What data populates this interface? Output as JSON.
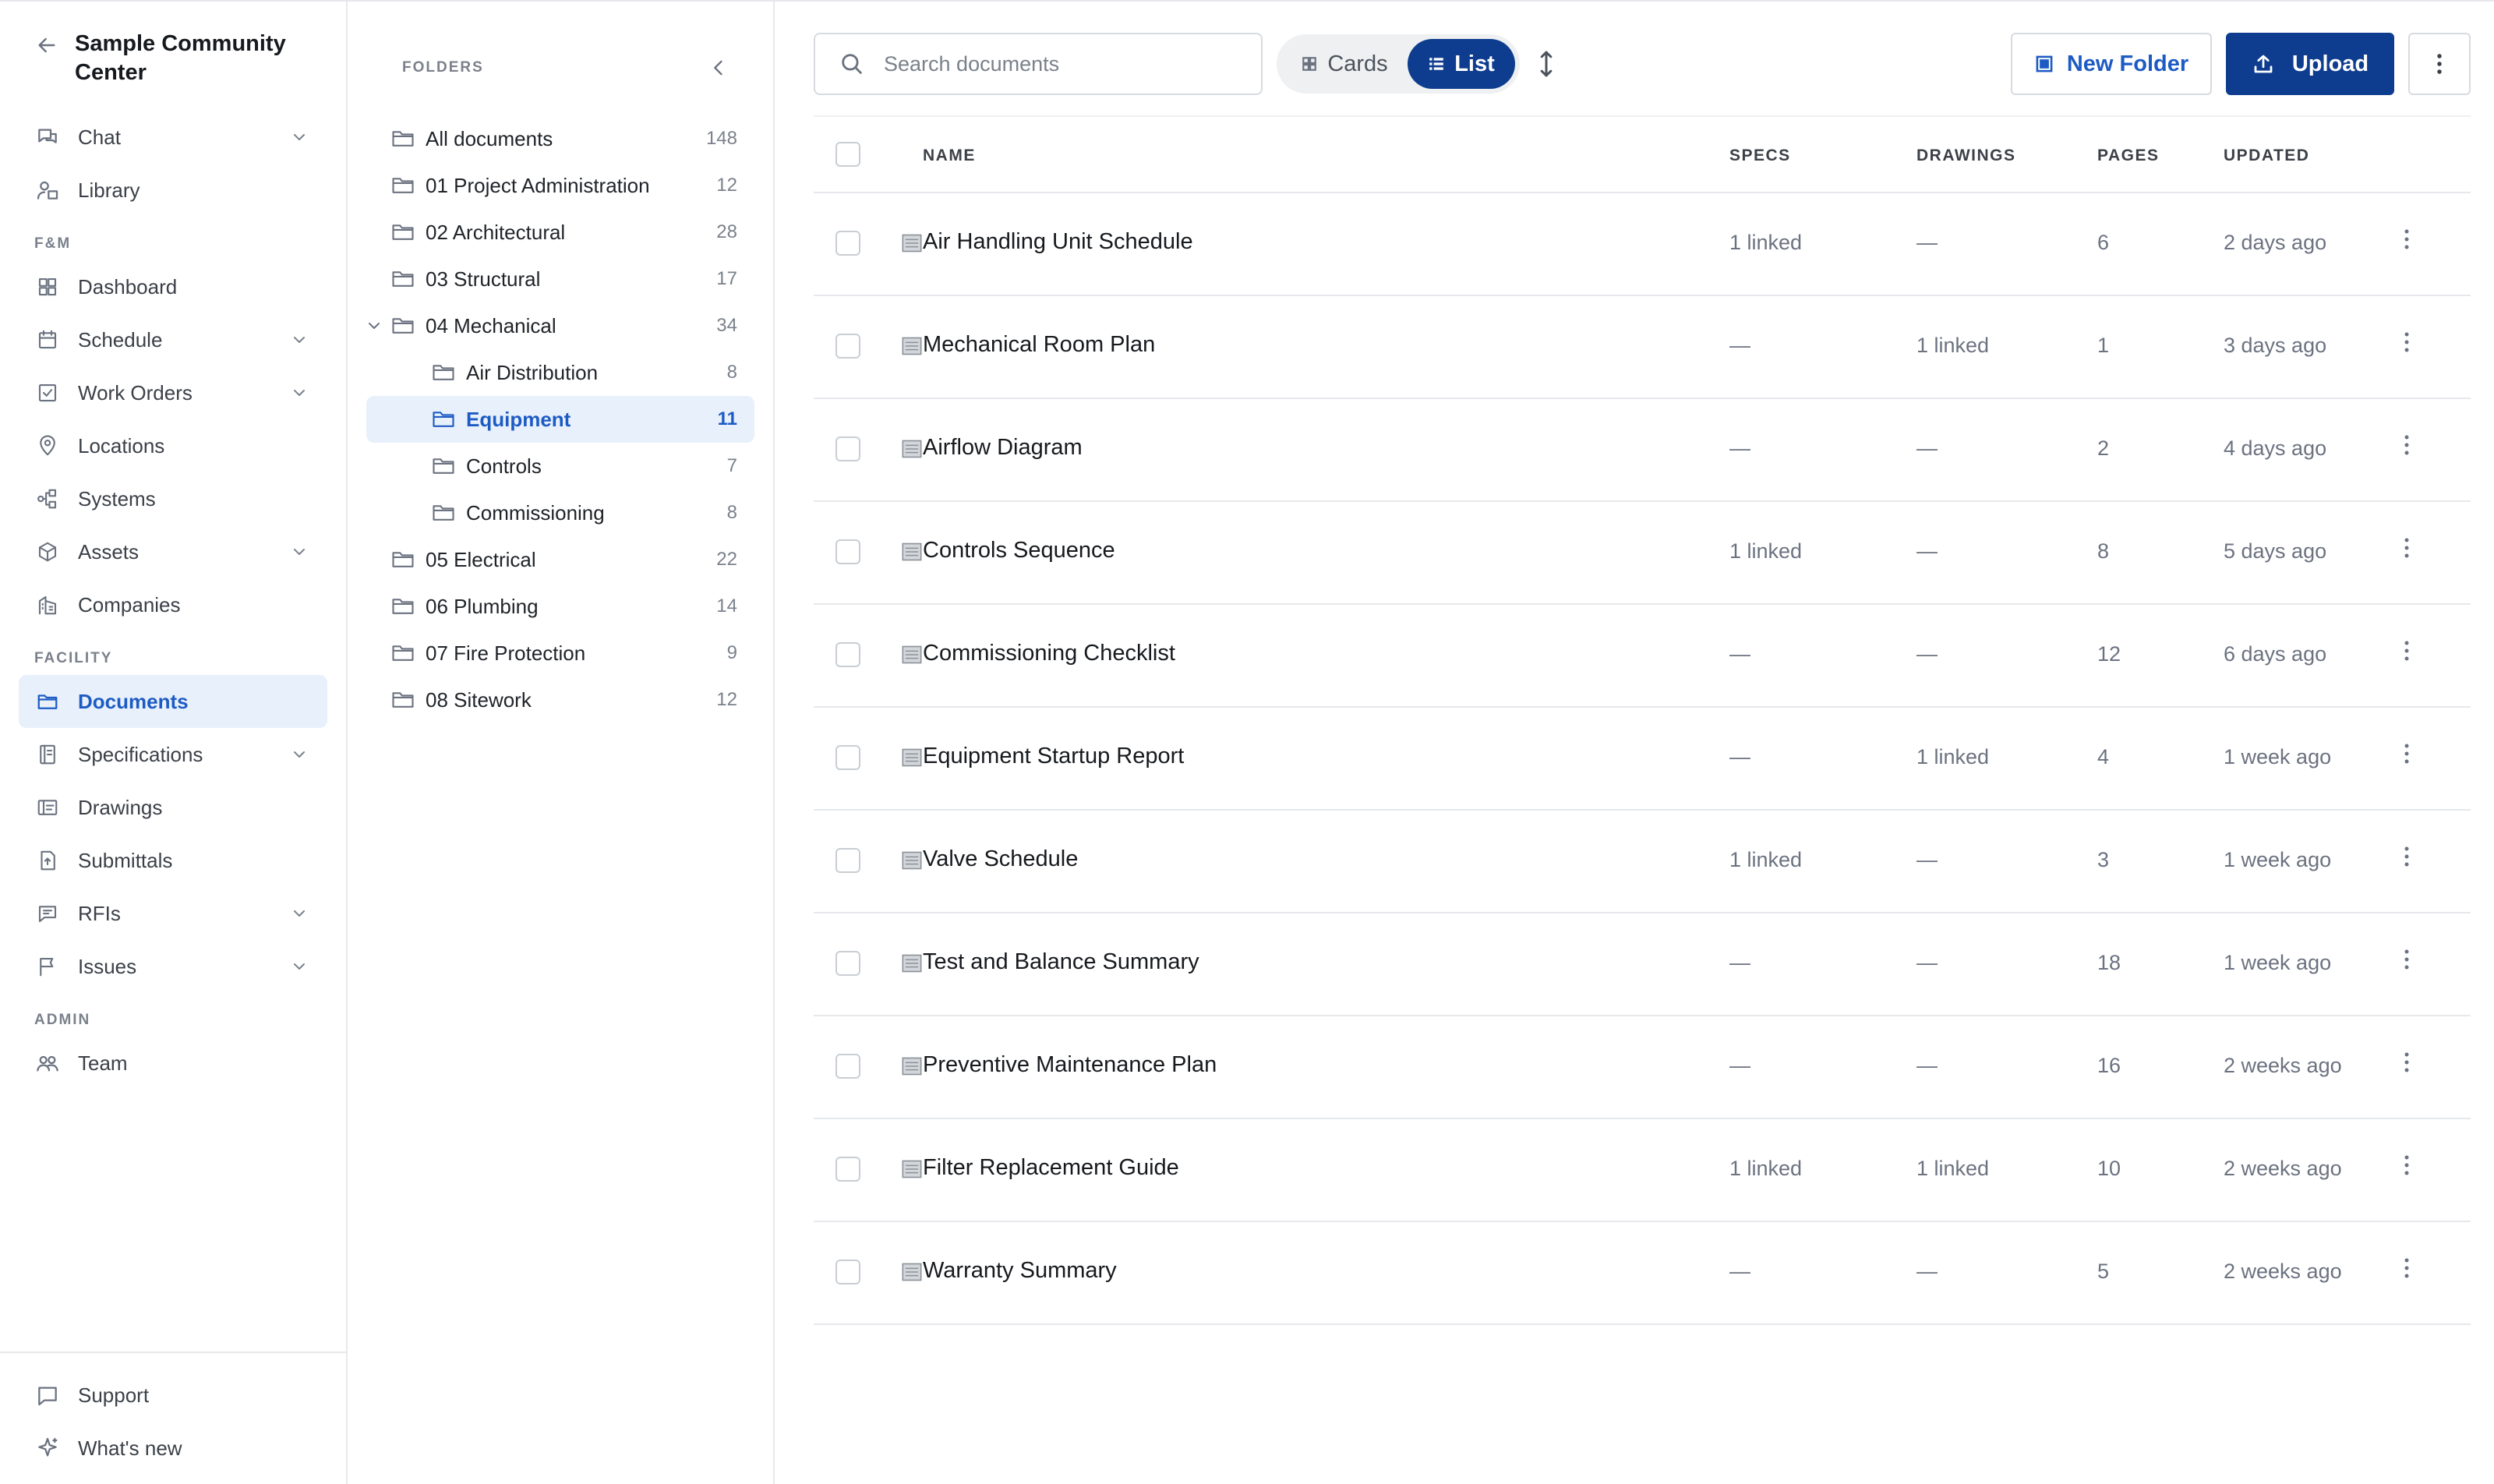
{
  "nav": {
    "org_name": "Sample Community Center",
    "top_items": [
      {
        "label": "Chat",
        "icon": "chat-icon",
        "has_chevron": true
      },
      {
        "label": "Library",
        "icon": "library-icon",
        "has_chevron": false
      }
    ],
    "section_fm": "F&M",
    "fm_items": [
      {
        "label": "Dashboard",
        "icon": "dashboard-icon",
        "has_chevron": false
      },
      {
        "label": "Schedule",
        "icon": "calendar-icon",
        "has_chevron": true
      },
      {
        "label": "Work Orders",
        "icon": "checkbox-icon",
        "has_chevron": true
      },
      {
        "label": "Locations",
        "icon": "location-pin-icon",
        "has_chevron": false
      },
      {
        "label": "Systems",
        "icon": "systems-icon",
        "has_chevron": false
      },
      {
        "label": "Assets",
        "icon": "cube-icon",
        "has_chevron": true
      },
      {
        "label": "Companies",
        "icon": "building-icon",
        "has_chevron": false
      }
    ],
    "section_facility": "FACILITY",
    "facility_items": [
      {
        "label": "Documents",
        "icon": "folder-icon",
        "has_chevron": false,
        "active": true
      },
      {
        "label": "Specifications",
        "icon": "specifications-icon",
        "has_chevron": true
      },
      {
        "label": "Drawings",
        "icon": "drawings-icon",
        "has_chevron": false
      },
      {
        "label": "Submittals",
        "icon": "submittals-icon",
        "has_chevron": false
      },
      {
        "label": "RFIs",
        "icon": "rfi-icon",
        "has_chevron": true
      },
      {
        "label": "Issues",
        "icon": "flag-icon",
        "has_chevron": true
      }
    ],
    "section_admin": "ADMIN",
    "admin_items": [
      {
        "label": "Team",
        "icon": "team-icon",
        "has_chevron": false
      }
    ],
    "bottom_items": [
      {
        "label": "Support",
        "icon": "support-icon"
      },
      {
        "label": "What's new",
        "icon": "sparkle-icon"
      }
    ]
  },
  "folders": {
    "title": "FOLDERS",
    "items": [
      {
        "label": "All documents",
        "count": "148",
        "level": 0
      },
      {
        "label": "01 Project Administration",
        "count": "12",
        "level": 0
      },
      {
        "label": "02 Architectural",
        "count": "28",
        "level": 0
      },
      {
        "label": "03 Structural",
        "count": "17",
        "level": 0
      },
      {
        "label": "04 Mechanical",
        "count": "34",
        "level": 0,
        "expanded": true
      },
      {
        "label": "Air Distribution",
        "count": "8",
        "level": 1
      },
      {
        "label": "Equipment",
        "count": "11",
        "level": 1,
        "active": true
      },
      {
        "label": "Controls",
        "count": "7",
        "level": 1
      },
      {
        "label": "Commissioning",
        "count": "8",
        "level": 1
      },
      {
        "label": "05 Electrical",
        "count": "22",
        "level": 0
      },
      {
        "label": "06 Plumbing",
        "count": "14",
        "level": 0
      },
      {
        "label": "07 Fire Protection",
        "count": "9",
        "level": 0
      },
      {
        "label": "08 Sitework",
        "count": "12",
        "level": 0
      }
    ]
  },
  "toolbar": {
    "search_placeholder": "Search documents",
    "view_cards": "Cards",
    "view_list": "List",
    "new_folder": "New Folder",
    "upload": "Upload"
  },
  "table": {
    "headers": {
      "name": "NAME",
      "specs": "SPECS",
      "drawings": "DRAWINGS",
      "pages": "PAGES",
      "updated": "UPDATED"
    },
    "rows": [
      {
        "name": "Air Handling Unit Schedule",
        "specs": "1 linked",
        "drawings": "—",
        "pages": "6",
        "updated": "2 days ago"
      },
      {
        "name": "Mechanical Room Plan",
        "specs": "—",
        "drawings": "1 linked",
        "pages": "1",
        "updated": "3 days ago"
      },
      {
        "name": "Airflow Diagram",
        "specs": "—",
        "drawings": "—",
        "pages": "2",
        "updated": "4 days ago"
      },
      {
        "name": "Controls Sequence",
        "specs": "1 linked",
        "drawings": "—",
        "pages": "8",
        "updated": "5 days ago"
      },
      {
        "name": "Commissioning Checklist",
        "specs": "—",
        "drawings": "—",
        "pages": "12",
        "updated": "6 days ago"
      },
      {
        "name": "Equipment Startup Report",
        "specs": "—",
        "drawings": "1 linked",
        "pages": "4",
        "updated": "1 week ago"
      },
      {
        "name": "Valve Schedule",
        "specs": "1 linked",
        "drawings": "—",
        "pages": "3",
        "updated": "1 week ago"
      },
      {
        "name": "Test and Balance Summary",
        "specs": "—",
        "drawings": "—",
        "pages": "18",
        "updated": "1 week ago"
      },
      {
        "name": "Preventive Maintenance Plan",
        "specs": "—",
        "drawings": "—",
        "pages": "16",
        "updated": "2 weeks ago"
      },
      {
        "name": "Filter Replacement Guide",
        "specs": "1 linked",
        "drawings": "1 linked",
        "pages": "10",
        "updated": "2 weeks ago"
      },
      {
        "name": "Warranty Summary",
        "specs": "—",
        "drawings": "—",
        "pages": "5",
        "updated": "2 weeks ago"
      }
    ]
  },
  "colors": {
    "accent": "#0e3d8f",
    "link": "#1d5bc4",
    "active_bg": "#e8f0fb"
  }
}
